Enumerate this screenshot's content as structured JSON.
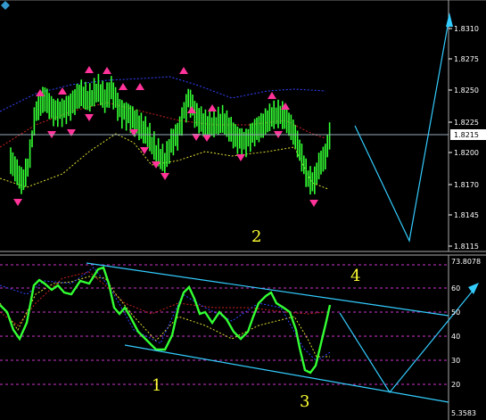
{
  "colors": {
    "background": "#000000",
    "price": "#33ff33",
    "indicator": "#33ff33",
    "arrow_up": "#ff3399",
    "arrow_down": "#ff3399",
    "channel": "#33ccff",
    "band_upper": "#3344ff",
    "band_mid": "#cc2222",
    "band_lower": "#dddd33",
    "level_line": "#cc33cc",
    "axis_text": "#ffffff",
    "annotation": "#ffff33",
    "separator": "#aaaaaa"
  },
  "price_panel": {
    "ticks": [
      "1.8310",
      "1.8275",
      "1.8250",
      "1.8225",
      "1.8200",
      "1.8170",
      "1.8145",
      "1.8115"
    ],
    "current_price": "1.8215",
    "annotation": "2"
  },
  "osc_panel": {
    "top_value": "73.8078",
    "bottom_value": "5.3583",
    "ticks": [
      "60",
      "50",
      "40",
      "30",
      "20"
    ],
    "annotations": [
      "4",
      "1",
      "3"
    ]
  },
  "icons": {
    "window_corner": "diamond-icon",
    "arrow_up": "triangle-up-icon",
    "arrow_down": "triangle-down-icon"
  }
}
